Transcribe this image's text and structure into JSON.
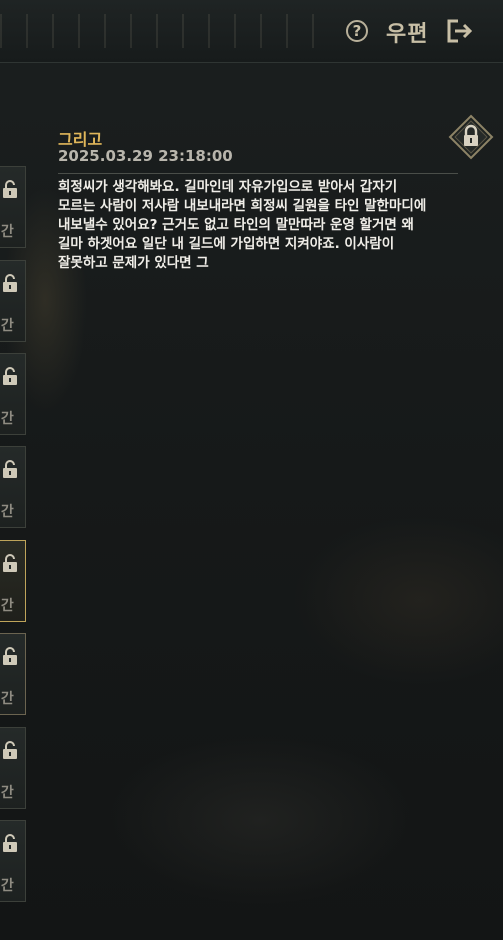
{
  "header": {
    "mail_label": "우편",
    "help_icon": "question-circle-icon",
    "exit_icon": "exit-door-icon"
  },
  "side_slots": [
    {
      "label": "시간",
      "state": "normal"
    },
    {
      "label": "시간",
      "state": "normal"
    },
    {
      "label": "시간",
      "state": "normal"
    },
    {
      "label": "시간",
      "state": "normal"
    },
    {
      "label": "시간",
      "state": "active"
    },
    {
      "label": "시간",
      "state": "dim"
    },
    {
      "label": "시간",
      "state": "normal"
    },
    {
      "label": "시간",
      "state": "normal"
    }
  ],
  "message": {
    "title": "그리고",
    "datetime": "2025.03.29 23:18:00",
    "body": "희정씨가 생각해봐요. 길마인데 자유가입으로 받아서 갑자기\n모르는 사람이 저사람 내보내라면 희정씨 길원을 타인 말한마디에\n내보낼수 있어요? 근거도 없고 타인의 말만따라 운영 할거면 왜\n길마 하겟어요 일단 내 길드에 가입하면 지켜야죠. 이사람이\n잘못하고 문제가 있다면 그"
  },
  "colors": {
    "accent_gold": "#e0b65a",
    "active_border": "#bfa45a",
    "text_muted": "#b9b6ad"
  }
}
